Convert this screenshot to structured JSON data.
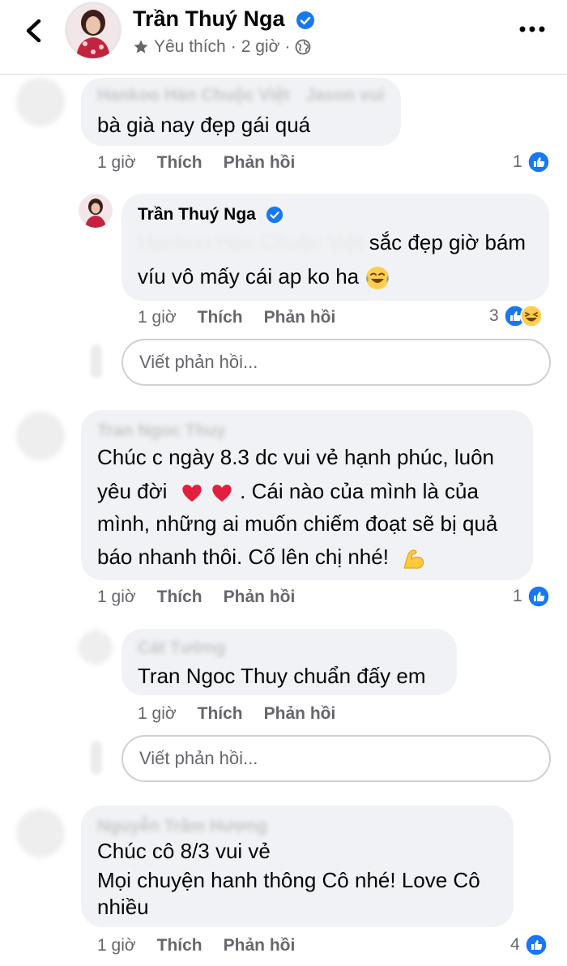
{
  "header": {
    "title": "Trần Thuý Nga",
    "meta_favorite": "Yêu thích",
    "meta_sep1": "·",
    "meta_time": "2 giờ",
    "meta_sep2": "·"
  },
  "comments": [
    {
      "author_blurred": "Hankoo Hàn Chuộc Việt",
      "author_suffix_blurred": "Jason vui",
      "text": "bà già nay đẹp gái quá",
      "time": "1 giờ",
      "like": "Thích",
      "reply": "Phản hồi",
      "reactions": "1",
      "reply_item": {
        "author": "Trần Thuý Nga",
        "text_line1_hidden": "Hankoo Hàn Chuộc Việt",
        "text_line1": "sắc đẹp giờ bám",
        "text_line2": "víu vô mấy cái ap ko ha",
        "time": "1 giờ",
        "like": "Thích",
        "reply": "Phản hồi",
        "reactions": "3"
      },
      "reply_placeholder": "Viết phản hồi..."
    },
    {
      "author_blurred": "Tran Ngoc Thuy",
      "text_line1": "Chúc c ngày 8.3 dc vui vẻ hạnh phúc, luôn",
      "text_line2a": "yêu đời",
      "text_line2b": ". Cái nào của mình là của",
      "text_line3": "mình, những ai muốn chiếm đoạt sẽ bị quả",
      "text_line4": "báo nhanh thôi. Cố lên chị nhé!",
      "time": "1 giờ",
      "like": "Thích",
      "reply": "Phản hồi",
      "reactions": "1",
      "reply_item": {
        "author_blurred": "Cát Tường",
        "text": "Tran Ngoc Thuy chuẩn đấy em",
        "time": "1 giờ",
        "like": "Thích",
        "reply": "Phản hồi"
      },
      "reply_placeholder": "Viết phản hồi..."
    },
    {
      "author_blurred": "Nguyễn Trâm Hương",
      "text_line1": "Chúc cô 8/3 vui vẻ",
      "text_line2": "Mọi chuyện hanh thông Cô nhé! Love Cô",
      "text_line3": "nhiều",
      "time": "1 giờ",
      "like": "Thích",
      "reply": "Phản hồi",
      "reactions": "4"
    }
  ],
  "colors": {
    "bubble": "#f0f2f5",
    "secondary_text": "#65676b",
    "like_blue": "#1877f2",
    "verified_blue": "#1877f2",
    "heart_red": "#e41e3f"
  },
  "icons": [
    "back-chevron-icon",
    "verified-icon",
    "star-icon",
    "globe-icon",
    "more-dots-icon",
    "like-icon",
    "haha-icon",
    "heart-icon",
    "flex-arm-icon",
    "laugh-tears-icon"
  ]
}
